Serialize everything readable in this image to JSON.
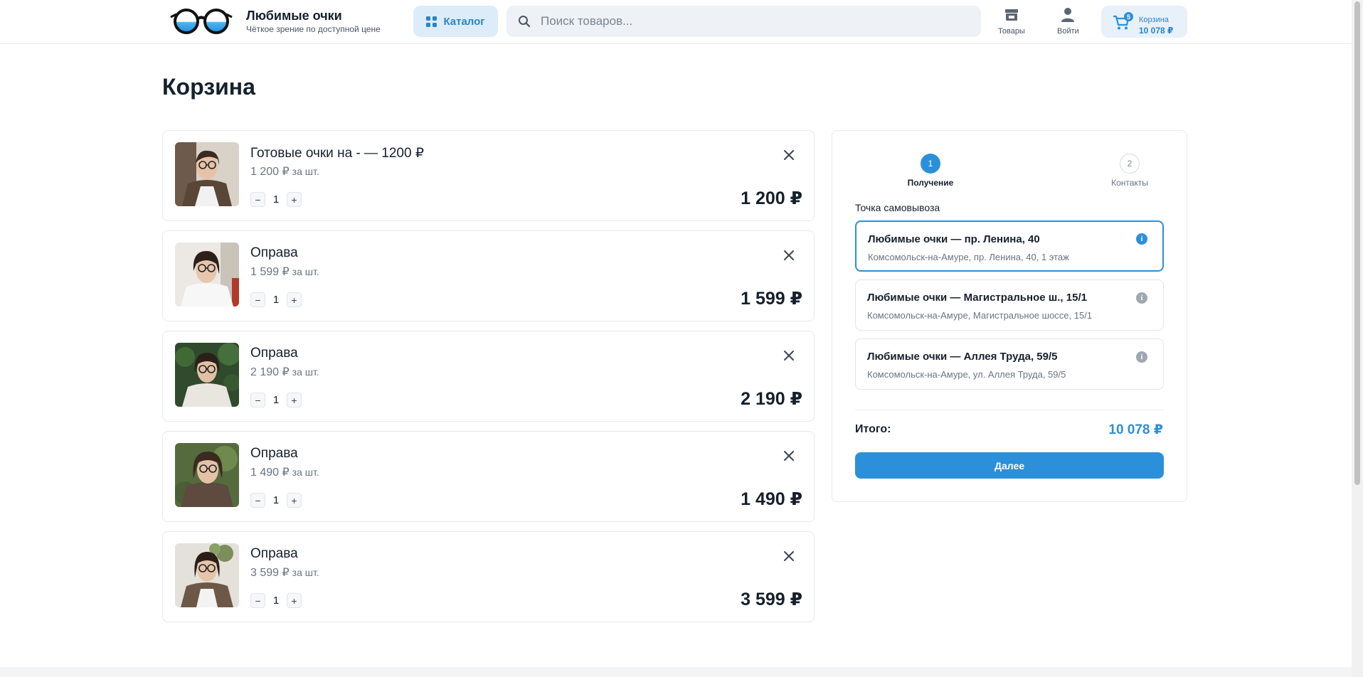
{
  "header": {
    "brand_title": "Любимые очки",
    "brand_subtitle": "Чёткое зрение по доступной цене",
    "catalog_label": "Каталог",
    "search_placeholder": "Поиск товаров...",
    "nav_products": "Товары",
    "nav_login": "Войти",
    "cart_label": "Корзина",
    "cart_count": "5",
    "cart_total": "10 078 ₽"
  },
  "page": {
    "title": "Корзина"
  },
  "cart": {
    "per_unit": "за шт.",
    "items": [
      {
        "name": "Готовые очки на - — 1200 ₽",
        "unit_price": "1 200 ₽",
        "qty": "1",
        "total": "1 200 ₽"
      },
      {
        "name": "Оправа",
        "unit_price": "1 599 ₽",
        "qty": "1",
        "total": "1 599 ₽"
      },
      {
        "name": "Оправа",
        "unit_price": "2 190 ₽",
        "qty": "1",
        "total": "2 190 ₽"
      },
      {
        "name": "Оправа",
        "unit_price": "1 490 ₽",
        "qty": "1",
        "total": "1 490 ₽"
      },
      {
        "name": "Оправа",
        "unit_price": "3 599 ₽",
        "qty": "1",
        "total": "3 599 ₽"
      }
    ]
  },
  "checkout": {
    "steps": [
      {
        "number": "1",
        "label": "Получение"
      },
      {
        "number": "2",
        "label": "Контакты"
      }
    ],
    "pickup_title": "Точка самовывоза",
    "pickup_points": [
      {
        "name": "Любимые очки — пр. Ленина, 40",
        "address": "Комсомольск-на-Амуре, пр. Ленина, 40, 1 этаж"
      },
      {
        "name": "Любимые очки — Магистральное ш., 15/1",
        "address": "Комсомольск-на-Амуре, Магистральное шоссе, 15/1"
      },
      {
        "name": "Любимые очки — Аллея Труда, 59/5",
        "address": "Комсомольск-на-Амуре, ул. Аллея Труда, 59/5"
      }
    ],
    "info_glyph": "i",
    "total_label": "Итого:",
    "total_value": "10 078 ₽",
    "next_label": "Далее"
  },
  "colors": {
    "accent": "#2b90d9",
    "accent_light": "#dcecf8",
    "text": "#16202c",
    "muted": "#6a7481"
  }
}
